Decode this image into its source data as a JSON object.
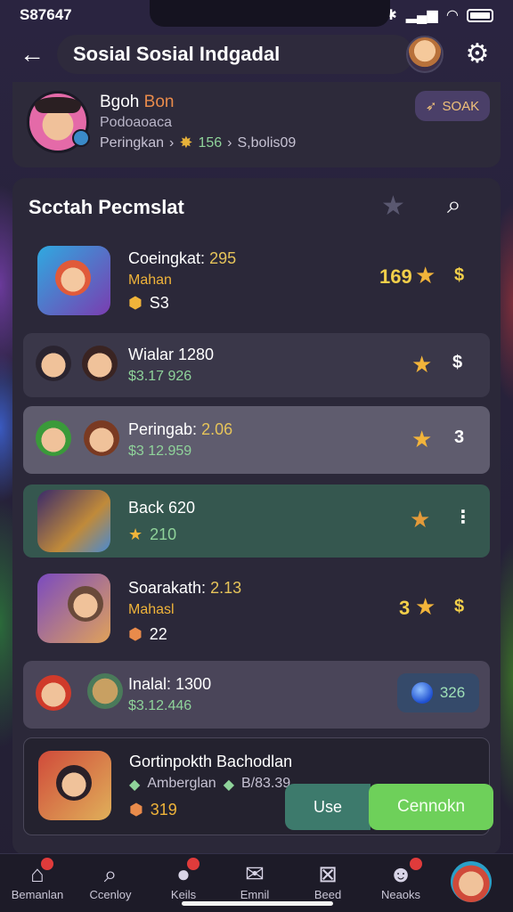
{
  "status": {
    "time": "S87647",
    "icons": [
      "bluetooth-icon",
      "signal-icon",
      "wifi-icon",
      "battery-icon"
    ]
  },
  "appbar": {
    "title": "Sosial Sosial Indgadal"
  },
  "profile": {
    "name_a": "Bgoh ",
    "name_b": "Bon",
    "sub": "Podoaoaca",
    "line_label": "Peringkan",
    "line_value": "156",
    "line_tail": "S,bolis09",
    "button": "SOAK"
  },
  "section": {
    "title": "Scctah Pecmslat"
  },
  "rows": [
    {
      "title": "Coeingkat:",
      "title_num": "295",
      "sub": "Mahan",
      "meta": "S3",
      "right_num": "169",
      "right_sym": "$"
    },
    {
      "title": "Wialar 1280",
      "sub": "$3.17 926",
      "right_sym": "$"
    },
    {
      "title": "Peringab:",
      "title_num": "2.06",
      "sub": "$3 12.959",
      "right_sym": "3"
    },
    {
      "title": "Back 620",
      "meta": "210",
      "right_sym": "⋮"
    },
    {
      "title": "Soarakath:",
      "title_num": "2.13",
      "sub": "Mahasl",
      "meta": "22",
      "right_num": "3",
      "right_sym": "$"
    },
    {
      "title": "Inalal: 1300",
      "sub": "$3.12.446",
      "gem_value": "326"
    },
    {
      "title": "Gortinpokth Bachodlan",
      "sub_a": "Amberglan",
      "sub_b": "B/83.39",
      "meta": "319"
    }
  ],
  "actions": {
    "use": "Use",
    "confirm": "Cennokn"
  },
  "nav": [
    {
      "label": "Bemanlan",
      "badge": ""
    },
    {
      "label": "Ccenloy"
    },
    {
      "label": "Keils",
      "badge": ""
    },
    {
      "label": "Emnil"
    },
    {
      "label": "Beed"
    },
    {
      "label": "Neaoks",
      "badge": ""
    }
  ],
  "colors": {
    "accent_gold": "#f2cf4a",
    "confirm_green": "#6ed05a",
    "use_teal": "#3d7a6c"
  }
}
